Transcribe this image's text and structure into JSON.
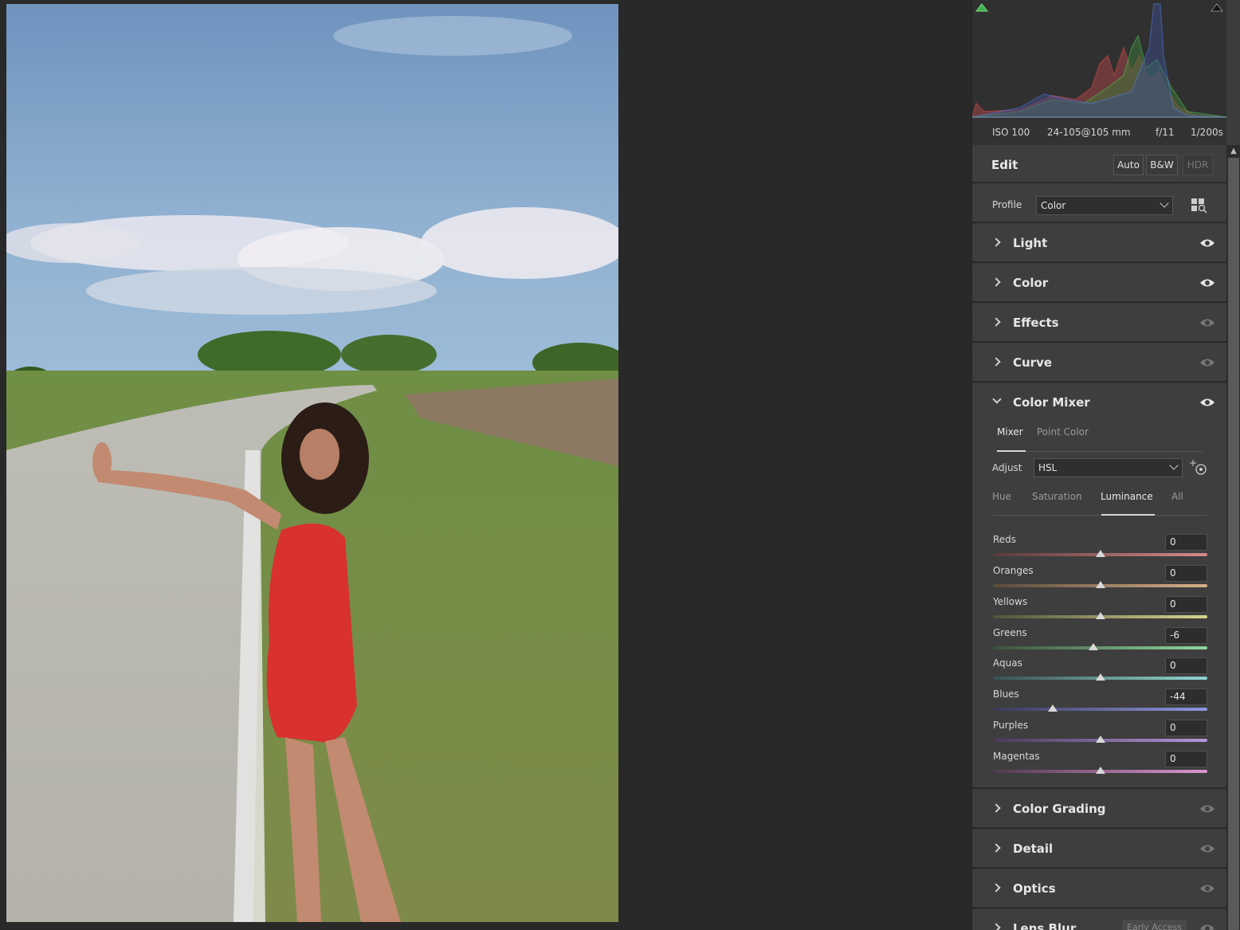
{
  "exif": {
    "iso": "ISO 100",
    "lens": "24-105@105 mm",
    "aperture": "f/11",
    "shutter": "1/200s"
  },
  "edit": {
    "title": "Edit",
    "auto": "Auto",
    "bw": "B&W",
    "hdr": "HDR"
  },
  "profile": {
    "label": "Profile",
    "value": "Color"
  },
  "sections_top": [
    {
      "title": "Light",
      "eye": "visible-eye-icon"
    },
    {
      "title": "Color",
      "eye": "visible-eye-icon"
    },
    {
      "title": "Effects",
      "eye": "dim-eye-icon"
    },
    {
      "title": "Curve",
      "eye": "dim-eye-icon"
    },
    {
      "title": "Color Mixer",
      "eye": "visible-eye-icon"
    }
  ],
  "mixer": {
    "tabs": [
      "Mixer",
      "Point Color"
    ],
    "adjust_label": "Adjust",
    "adjust_value": "HSL",
    "subtabs": [
      "Hue",
      "Saturation",
      "Luminance",
      "All"
    ],
    "sliders": [
      {
        "name": "Reds",
        "value": "0",
        "num": 0,
        "colors": [
          "#5a3a3a",
          "#d78a8a"
        ]
      },
      {
        "name": "Oranges",
        "value": "0",
        "num": 0,
        "colors": [
          "#5a4a3a",
          "#d8b08a"
        ]
      },
      {
        "name": "Yellows",
        "value": "0",
        "num": 0,
        "colors": [
          "#52523a",
          "#d6d690"
        ]
      },
      {
        "name": "Greens",
        "value": "-6",
        "num": -6,
        "colors": [
          "#3a523e",
          "#8fd69a"
        ]
      },
      {
        "name": "Aquas",
        "value": "0",
        "num": 0,
        "colors": [
          "#3a5252",
          "#8fd6d0"
        ]
      },
      {
        "name": "Blues",
        "value": "-44",
        "num": -44,
        "colors": [
          "#3a3a5a",
          "#8f96e0"
        ]
      },
      {
        "name": "Purples",
        "value": "0",
        "num": 0,
        "colors": [
          "#4a3a5a",
          "#b596dc"
        ]
      },
      {
        "name": "Magentas",
        "value": "0",
        "num": 0,
        "colors": [
          "#523a50",
          "#dc96d2"
        ]
      }
    ]
  },
  "sections_bottom": [
    {
      "title": "Color Grading"
    },
    {
      "title": "Detail"
    },
    {
      "title": "Optics"
    },
    {
      "title": "Lens Blur",
      "badge": "Early Access"
    }
  ]
}
